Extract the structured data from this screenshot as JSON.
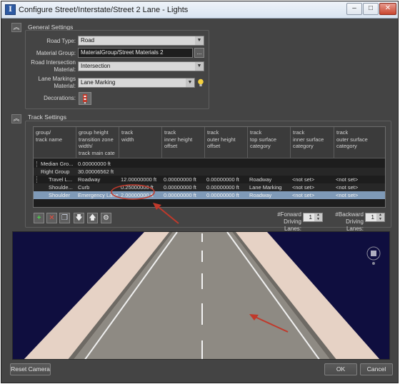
{
  "window": {
    "title": "Configure Street/Interstate/Street 2 Lane - Lights"
  },
  "general": {
    "title": "General Settings",
    "road_type": {
      "label": "Road Type:",
      "value": "Road"
    },
    "material_group": {
      "label": "Material Group:",
      "value": "MaterialGroup/Street Materials 2",
      "browse": "..."
    },
    "intersection_material": {
      "label_line1": "Road Intersection",
      "label_line2": "Material:",
      "value": "Intersection"
    },
    "lane_marking_material": {
      "label_line1": "Lane Markings",
      "label_line2": "Material:",
      "value": "Lane Marking"
    },
    "decorations": {
      "label": "Decorations:"
    }
  },
  "track": {
    "title": "Track Settings",
    "headers": [
      [
        "group/",
        "track name"
      ],
      [
        "group height",
        "transition zone",
        "width/",
        "track main cate"
      ],
      [
        "track",
        "width"
      ],
      [
        "track",
        "inner height",
        "offset"
      ],
      [
        "track",
        "outer height",
        "offset"
      ],
      [
        "track",
        "top surface",
        "category"
      ],
      [
        "track",
        "inner surface",
        "category"
      ],
      [
        "track",
        "outer surface",
        "category"
      ]
    ],
    "rows": [
      {
        "c0": "Median Gro...",
        "c1": "0.00000000 ft",
        "c2": "",
        "c3": "",
        "c4": "",
        "c5": "",
        "c6": "",
        "c7": ""
      },
      {
        "c0": "Right Group",
        "c1": "30.00006562 ft",
        "c2": "",
        "c3": "",
        "c4": "",
        "c5": "",
        "c6": "",
        "c7": ""
      },
      {
        "c0": "Travel L...",
        "c1": "Roadway",
        "c2": "12.00000000 ft",
        "c3": "0.00000000 ft",
        "c4": "0.00000000 ft",
        "c5": "Roadway",
        "c6": "<not set>",
        "c7": "<not set>"
      },
      {
        "c0": "Shoulde...",
        "c1": "Curb",
        "c2": "0.25000000 ft",
        "c3": "0.00000000 ft",
        "c4": "0.00000000 ft",
        "c5": "Lane Marking",
        "c6": "<not set>",
        "c7": "<not set>"
      },
      {
        "c0": "Shoulder",
        "c1": "Emergency Lane",
        "c2": "2.00000000 ft",
        "c3": "0.00000000 ft",
        "c4": "0.00000000 ft",
        "c5": "Roadway",
        "c6": "<not set>",
        "c7": "<not set>"
      }
    ],
    "forward_label": [
      "#Forward",
      "Driving Lanes:"
    ],
    "forward_value": "1",
    "backward_label": [
      "#Backward",
      "Driving Lanes:"
    ],
    "backward_value": "1"
  },
  "footer": {
    "reset_camera": "Reset Camera",
    "ok": "OK",
    "cancel": "Cancel"
  },
  "colors": {
    "highlight_circle": "#c0392b",
    "arrow": "#c0392b",
    "selected_row": "#7f9ab8",
    "sky": "#0f0e3f"
  },
  "icons": [
    "app-icon",
    "minimize-icon",
    "maximize-icon",
    "close-icon",
    "collapse-icon",
    "bulb-icon",
    "decoration-icon",
    "add-icon",
    "remove-icon",
    "copy-icon",
    "move-down-icon",
    "move-up-icon",
    "settings-icon",
    "compass-icon"
  ]
}
